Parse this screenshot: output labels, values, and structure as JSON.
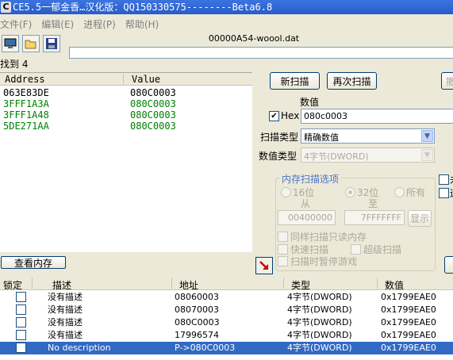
{
  "window": {
    "title": "CE5.5一郁金香…汉化版：QQ150330575--------Beta6.8"
  },
  "menu": [
    "文件(F)",
    "编辑(E)",
    "进程(P)",
    "帮助(H)"
  ],
  "toolbar": {
    "filename": "00000A54-woool.dat"
  },
  "found": {
    "label": "找到 4"
  },
  "address_list": {
    "headers": {
      "address": "Address",
      "value": "Value"
    },
    "rows": [
      {
        "address": "063E83DE",
        "value": "080C0003",
        "color": "#000000"
      },
      {
        "address": "3FFF1A3A",
        "value": "080C0003",
        "color": "#008000"
      },
      {
        "address": "3FFF1A48",
        "value": "080C0003",
        "color": "#008000"
      },
      {
        "address": "5DE271AA",
        "value": "080C0003",
        "color": "#008000"
      }
    ]
  },
  "scan": {
    "new_scan": "新扫描",
    "next_scan": "再次扫描",
    "undo": "撤",
    "value_label": "数值",
    "hex_label": "Hex",
    "hex_checked": true,
    "value": "080c0003",
    "scan_type_label": "扫描类型",
    "scan_type": "精确数值",
    "value_type_label": "数值类型",
    "value_type": "4字节(DWORD)",
    "mem_options_title": "内存扫描选项",
    "radio_16": "16位",
    "radio_32": "32位",
    "radio_all": "所有",
    "from_label": "从",
    "to_label": "至",
    "from_value": "00400000",
    "to_value": "7FFFFFFF",
    "show_button": "显示",
    "opt_readonly": "同样扫描只读内存",
    "opt_fast": "快速扫描",
    "opt_super": "超级扫描",
    "opt_pause": "扫描时暂停游戏",
    "right_check1": "未",
    "right_check2": "遗"
  },
  "view_memory": "查看内存",
  "bottom_table": {
    "headers": {
      "lock": "锁定",
      "desc": "描述",
      "addr": "地址",
      "type": "类型",
      "value": "数值"
    },
    "rows": [
      {
        "desc": "没有描述",
        "addr": "08060003",
        "type": "4字节(DWORD)",
        "value": "0x1799EAE0",
        "selected": false
      },
      {
        "desc": "没有描述",
        "addr": "08070003",
        "type": "4字节(DWORD)",
        "value": "0x1799EAE0",
        "selected": false
      },
      {
        "desc": "没有描述",
        "addr": "080C0003",
        "type": "4字节(DWORD)",
        "value": "0x1799EAE0",
        "selected": false
      },
      {
        "desc": "没有描述",
        "addr": "17996574",
        "type": "4字节(DWORD)",
        "value": "0x1799EAE0",
        "selected": false
      },
      {
        "desc": "No description",
        "addr": "P->080C0003",
        "type": "4字节(DWORD)",
        "value": "0x1799EAE0",
        "selected": true
      }
    ]
  }
}
